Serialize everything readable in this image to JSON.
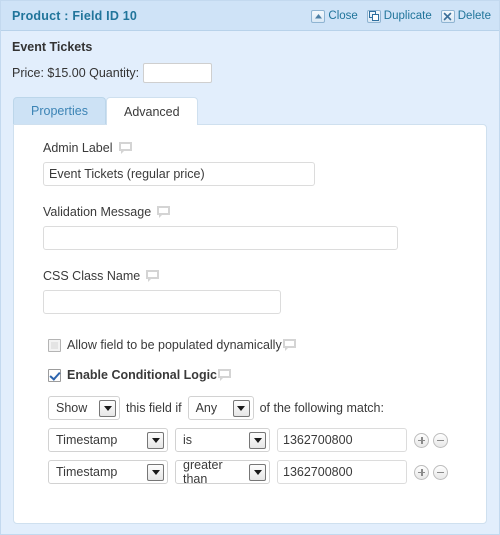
{
  "header": {
    "title": "Product : Field ID 10",
    "actions": [
      {
        "label": "Close",
        "icon": "collapse-up-icon"
      },
      {
        "label": "Duplicate",
        "icon": "copy-icon"
      },
      {
        "label": "Delete",
        "icon": "x-icon"
      }
    ]
  },
  "preview": {
    "product_name": "Event Tickets",
    "price_label": "Price: $15.00 Quantity:",
    "quantity_value": ""
  },
  "tabs": [
    {
      "label": "Properties",
      "active": false
    },
    {
      "label": "Advanced",
      "active": true
    }
  ],
  "advanced": {
    "admin_label": {
      "label": "Admin Label",
      "value": "Event Tickets (regular price)",
      "placeholder": ""
    },
    "validation_message": {
      "label": "Validation Message",
      "value": "",
      "placeholder": ""
    },
    "css_class_name": {
      "label": "CSS Class Name",
      "value": "",
      "placeholder": ""
    },
    "populate_dynamically": {
      "label": "Allow field to be populated dynamically",
      "checked": false
    },
    "conditional_logic": {
      "label": "Enable Conditional Logic",
      "checked": true,
      "action": "Show",
      "text_before_match": "this field if",
      "match_type": "Any",
      "text_after_match": "of the following match:",
      "rules": [
        {
          "field": "Timestamp",
          "operator": "is",
          "value": "1362700800"
        },
        {
          "field": "Timestamp",
          "operator": "greater than",
          "value": "1362700800"
        }
      ],
      "add_label": "+",
      "remove_label": "−"
    }
  }
}
